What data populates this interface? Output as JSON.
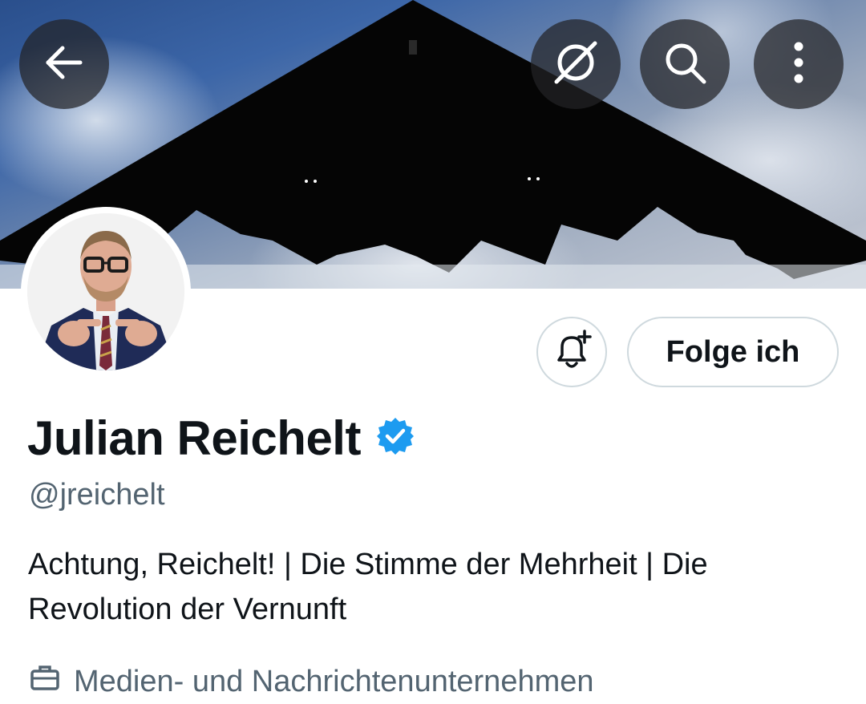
{
  "header": {
    "back_icon": "arrow-left-icon",
    "grok_icon": "grok-icon",
    "search_icon": "search-icon",
    "more_icon": "more-vertical-icon"
  },
  "profile": {
    "name": "Julian Reichelt",
    "verified": true,
    "verified_color": "#1d9bf0",
    "handle": "@jreichelt",
    "bio": "Achtung, Reichelt! |  Die Stimme der Mehrheit |   Die Revolution der Vernunft",
    "category": "Medien- und Nachrichtenunternehmen"
  },
  "actions": {
    "notify_icon": "bell-plus-icon",
    "follow_label": "Folge ich"
  },
  "colors": {
    "text": "#0f1419",
    "secondary": "#536471",
    "border": "#cfd9de",
    "accent": "#1d9bf0"
  }
}
